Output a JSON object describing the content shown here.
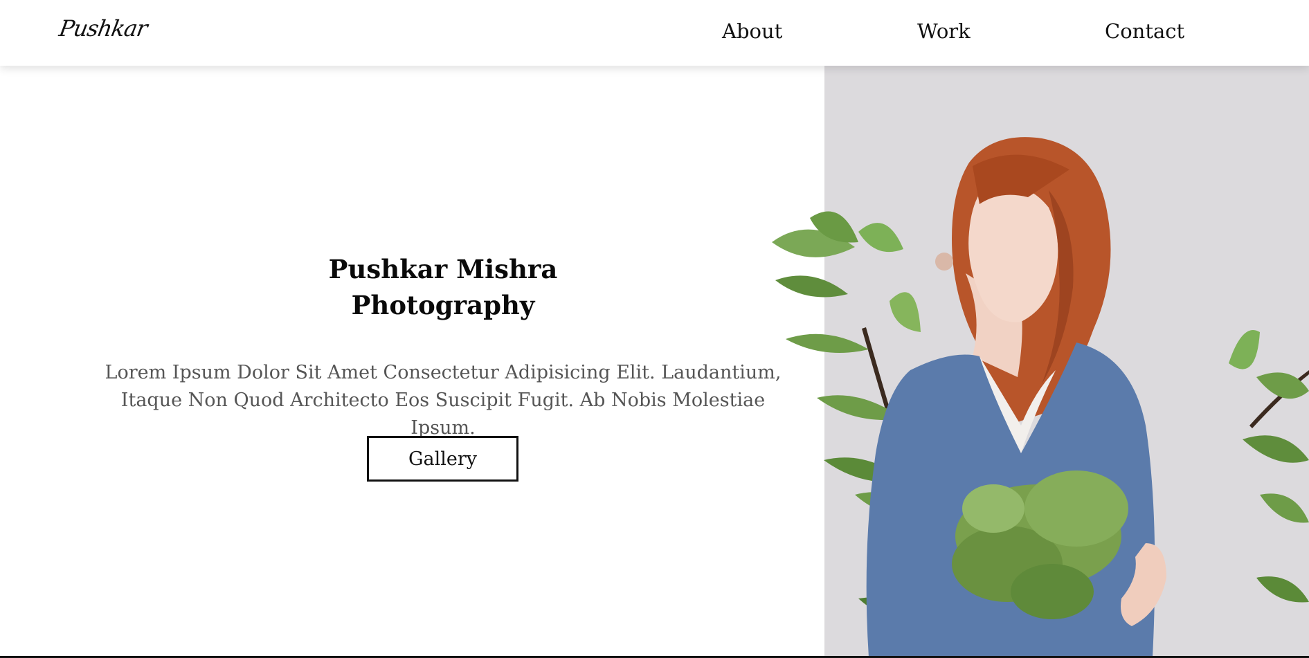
{
  "header": {
    "logo": "Pushkar",
    "nav": {
      "about": "About",
      "work": "Work",
      "contact": "Contact"
    }
  },
  "hero": {
    "title_line1": "Pushkar Mishra",
    "title_line2": "Photography",
    "description_line1": "Lorem Ipsum Dolor Sit Amet Consectetur Adipisicing Elit. Laudantium,",
    "description_line2": "Itaque Non Quod Architecto Eos Suscipit Fugit. Ab Nobis Molestiae Ipsum.",
    "gallery_label": "Gallery"
  },
  "colors": {
    "photo_background": "#dcdadd",
    "hair": "#b8552a",
    "sweater": "#5b7bab",
    "leaf": "#6d9a45",
    "text_muted": "#555555"
  }
}
